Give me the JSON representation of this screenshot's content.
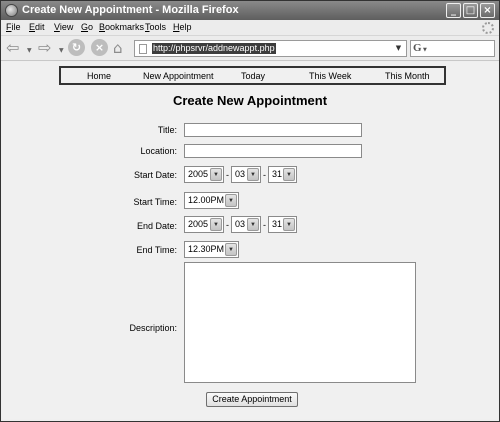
{
  "window": {
    "title": "Create New Appointment - Mozilla Firefox",
    "controls": [
      "minimize",
      "maximize",
      "close"
    ]
  },
  "menu": {
    "items": [
      {
        "key": "F",
        "rest": "ile"
      },
      {
        "key": "E",
        "rest": "dit"
      },
      {
        "key": "V",
        "rest": "iew"
      },
      {
        "key": "G",
        "rest": "o"
      },
      {
        "key": "B",
        "rest": "ookmarks"
      },
      {
        "key": "T",
        "rest": "ools"
      },
      {
        "key": "H",
        "rest": "elp"
      }
    ]
  },
  "toolbar": {
    "url": "http://phpsrvr/addnewappt.php",
    "search_engine_icon": "G"
  },
  "appnav": {
    "links": [
      "Home",
      "New Appointment",
      "Today",
      "This Week",
      "This Month"
    ]
  },
  "form": {
    "heading": "Create New Appointment",
    "title_label": "Title:",
    "title_value": "",
    "location_label": "Location:",
    "location_value": "",
    "start_date_label": "Start Date:",
    "start_date": {
      "year": "2005",
      "month": "03",
      "day": "31"
    },
    "start_time_label": "Start Time:",
    "start_time": "12.00PM",
    "end_date_label": "End Date:",
    "end_date": {
      "year": "2005",
      "month": "03",
      "day": "31"
    },
    "end_time_label": "End Time:",
    "end_time": "12.30PM",
    "date_separator": "-",
    "description_label": "Description:",
    "description_value": "",
    "submit_label": "Create Appointment"
  }
}
